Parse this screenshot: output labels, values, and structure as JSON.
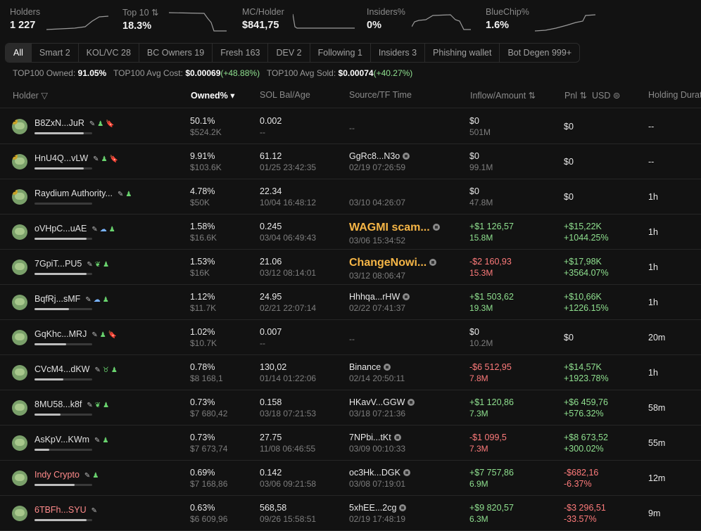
{
  "stats": [
    {
      "label": "Holders",
      "value": "1 227"
    },
    {
      "label": "Top 10 ⇅",
      "value": "18.3%"
    },
    {
      "label": "MC/Holder",
      "value": "$841,75"
    },
    {
      "label": "Insiders%",
      "value": "0%"
    },
    {
      "label": "BlueChip%",
      "value": "1.6%"
    }
  ],
  "tabs": [
    "All",
    "Smart 2",
    "KOL/VC 28",
    "BC Owners 19",
    "Fresh 163",
    "DEV 2",
    "Following 1",
    "Insiders 3",
    "Phishing wallet",
    "Bot Degen 999+"
  ],
  "summary": {
    "owned_label": "TOP100 Owned:",
    "owned_value": "91.05%",
    "cost_label": "TOP100 Avg Cost:",
    "cost_value": "$0.00069",
    "cost_change": "(+48.88%)",
    "sold_label": "TOP100 Avg Sold:",
    "sold_value": "$0.00074",
    "sold_change": "(+40.27%)"
  },
  "headers": {
    "holder": "Holder",
    "owned": "Owned% ▾",
    "sol": "SOL Bal/Age",
    "source": "Source/TF Time",
    "inflow": "Inflow/Amount ⇅",
    "pnl": "Pnl ⇅",
    "usd": "USD ⊜",
    "holding": "Holding Durati"
  },
  "rows": [
    {
      "rank": "1",
      "name": "B8ZxN...JuR",
      "name_color": "default",
      "tags": [
        "edit",
        "user",
        "red"
      ],
      "bar": 0.85,
      "owned": "50.1%",
      "owned_usd": "$524.2K",
      "sol": "0.002",
      "age": "--",
      "source": "--",
      "source_style": "muted",
      "source_time": "",
      "inflow": "$0",
      "inflow_style": "default",
      "amount": "501M",
      "amount_style": "muted",
      "pnl": "$0",
      "pnl_style": "default",
      "pnl_pct": "",
      "holding": "--"
    },
    {
      "rank": "2",
      "name": "HnU4Q...vLW",
      "name_color": "default",
      "tags": [
        "edit",
        "user",
        "red"
      ],
      "bar": 0.85,
      "owned": "9.91%",
      "owned_usd": "$103.6K",
      "sol": "61.12",
      "age": "01/25 23:42:35",
      "source": "GgRc8...N3o",
      "source_style": "default",
      "source_time": "02/19 07:26:59",
      "inflow": "$0",
      "inflow_style": "default",
      "amount": "99.1M",
      "amount_style": "muted",
      "pnl": "$0",
      "pnl_style": "default",
      "pnl_pct": "",
      "holding": "--"
    },
    {
      "rank": "3",
      "name": "Raydium Authority...",
      "name_color": "default",
      "tags": [
        "edit",
        "user"
      ],
      "bar": 0,
      "owned": "4.78%",
      "owned_usd": "$50K",
      "sol": "22.34",
      "age": "10/04 16:48:12",
      "source": "",
      "source_style": "default",
      "source_time": "03/10 04:26:07",
      "inflow": "$0",
      "inflow_style": "default",
      "amount": "47.8M",
      "amount_style": "muted",
      "pnl": "$0",
      "pnl_style": "default",
      "pnl_pct": "",
      "holding": "1h"
    },
    {
      "rank": "",
      "name": "oVHpC...uAE",
      "name_color": "default",
      "tags": [
        "edit",
        "blue",
        "user"
      ],
      "bar": 0.9,
      "owned": "1.58%",
      "owned_usd": "$16.6K",
      "sol": "0.245",
      "age": "03/04 06:49:43",
      "source": "WAGMI scam...",
      "source_style": "wagmi",
      "source_time": "03/06 15:34:52",
      "inflow": "+$1 126,57",
      "inflow_style": "pos",
      "amount": "15.8M",
      "amount_style": "pos",
      "pnl": "+$15,22K",
      "pnl_style": "pos",
      "pnl_pct": "+1044.25%",
      "holding": "1h"
    },
    {
      "rank": "",
      "name": "7GpiT...PU5",
      "name_color": "default",
      "tags": [
        "edit",
        "leaf",
        "user"
      ],
      "bar": 0.9,
      "owned": "1.53%",
      "owned_usd": "$16K",
      "sol": "21.06",
      "age": "03/12 08:14:01",
      "source": "ChangeNowi...",
      "source_style": "wagmi",
      "source_time": "03/12 08:06:47",
      "inflow": "-$2 160,93",
      "inflow_style": "neg",
      "amount": "15.3M",
      "amount_style": "neg",
      "pnl": "+$17,98K",
      "pnl_style": "pos",
      "pnl_pct": "+3564.07%",
      "holding": "1h"
    },
    {
      "rank": "",
      "name": "BqfRj...sMF",
      "name_color": "default",
      "tags": [
        "edit",
        "blue",
        "user"
      ],
      "bar": 0.6,
      "owned": "1.12%",
      "owned_usd": "$11.7K",
      "sol": "24.95",
      "age": "02/21 22:07:14",
      "source": "Hhhqa...rHW",
      "source_style": "default",
      "source_time": "02/22 07:41:37",
      "inflow": "+$1 503,62",
      "inflow_style": "pos",
      "amount": "19.3M",
      "amount_style": "pos",
      "pnl": "+$10,66K",
      "pnl_style": "pos",
      "pnl_pct": "+1226.15%",
      "holding": "1h"
    },
    {
      "rank": "",
      "name": "GqKhc...MRJ",
      "name_color": "default",
      "tags": [
        "edit",
        "user",
        "red"
      ],
      "bar": 0.55,
      "owned": "1.02%",
      "owned_usd": "$10.7K",
      "sol": "0.007",
      "age": "--",
      "source": "--",
      "source_style": "muted",
      "source_time": "",
      "inflow": "$0",
      "inflow_style": "default",
      "amount": "10.2M",
      "amount_style": "muted",
      "pnl": "$0",
      "pnl_style": "default",
      "pnl_pct": "",
      "holding": "20m"
    },
    {
      "rank": "",
      "name": "CVcM4...dKW",
      "name_color": "default",
      "tags": [
        "edit",
        "bull",
        "user"
      ],
      "bar": 0.5,
      "owned": "0.78%",
      "owned_usd": "$8 168,1",
      "sol": "130,02",
      "age": "01/14 01:22:06",
      "source": "Binance",
      "source_style": "default",
      "source_time": "02/14 20:50:11",
      "inflow": "-$6 512,95",
      "inflow_style": "neg",
      "amount": "7.8M",
      "amount_style": "neg",
      "pnl": "+$14,57K",
      "pnl_style": "pos",
      "pnl_pct": "+1923.78%",
      "holding": "1h"
    },
    {
      "rank": "",
      "name": "8MU58...k8f",
      "name_color": "default",
      "tags": [
        "edit",
        "leaf",
        "user"
      ],
      "bar": 0.45,
      "owned": "0.73%",
      "owned_usd": "$7 680,42",
      "sol": "0.158",
      "age": "03/18 07:21:53",
      "source": "HKavV...GGW",
      "source_style": "default",
      "source_time": "03/18 07:21:36",
      "inflow": "+$1 120,86",
      "inflow_style": "pos",
      "amount": "7.3M",
      "amount_style": "pos",
      "pnl": "+$6 459,76",
      "pnl_style": "pos",
      "pnl_pct": "+576.32%",
      "holding": "58m"
    },
    {
      "rank": "",
      "name": "AsKpV...KWm",
      "name_color": "default",
      "tags": [
        "edit",
        "user"
      ],
      "bar": 0.25,
      "owned": "0.73%",
      "owned_usd": "$7 673,74",
      "sol": "27.75",
      "age": "11/08 06:46:55",
      "source": "7NPbi...tKt",
      "source_style": "default",
      "source_time": "03/09 00:10:33",
      "inflow": "-$1 099,5",
      "inflow_style": "neg",
      "amount": "7.3M",
      "amount_style": "neg",
      "pnl": "+$8 673,52",
      "pnl_style": "pos",
      "pnl_pct": "+300.02%",
      "holding": "55m"
    },
    {
      "rank": "",
      "name": "Indy Crypto",
      "name_color": "red",
      "tags": [
        "edit",
        "user"
      ],
      "bar": 0.7,
      "owned": "0.69%",
      "owned_usd": "$7 168,86",
      "sol": "0.142",
      "age": "03/06 09:21:58",
      "source": "oc3Hk...DGK",
      "source_style": "default",
      "source_time": "03/08 07:19:01",
      "inflow": "+$7 757,86",
      "inflow_style": "pos",
      "amount": "6.9M",
      "amount_style": "pos",
      "pnl": "-$682,16",
      "pnl_style": "neg",
      "pnl_pct": "-6.37%",
      "holding": "12m"
    },
    {
      "rank": "",
      "name": "6TBFh...SYU",
      "name_color": "red",
      "tags": [
        "edit"
      ],
      "bar": 0.9,
      "owned": "0.63%",
      "owned_usd": "$6 609,96",
      "sol": "568,58",
      "age": "09/26 15:58:51",
      "source": "5xhEE...2cg",
      "source_style": "default",
      "source_time": "02/19 17:48:19",
      "inflow": "+$9 820,57",
      "inflow_style": "pos",
      "amount": "6.3M",
      "amount_style": "pos",
      "pnl": "-$3 296,51",
      "pnl_style": "neg",
      "pnl_pct": "-33.57%",
      "holding": "9m"
    }
  ]
}
